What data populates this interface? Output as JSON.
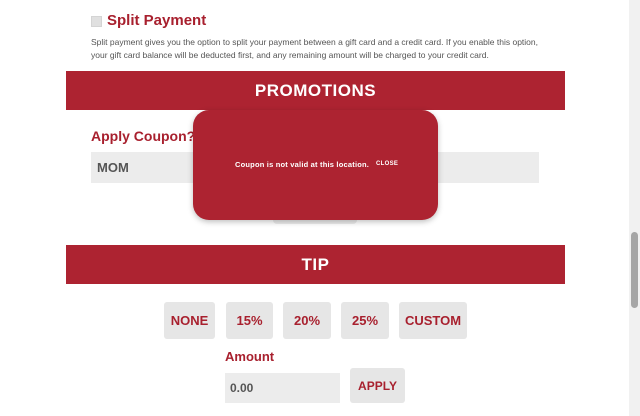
{
  "split_payment": {
    "title": "Split Payment",
    "description": "Split payment gives you the option to split your payment between a gift card and a credit card. If you enable this option, your gift card balance will be deducted first, and any remaining amount will be charged to your credit card."
  },
  "promotions": {
    "banner": "PROMOTIONS",
    "coupon_label": "Apply Coupon?",
    "coupon_value": "MOM"
  },
  "modal": {
    "message": "Coupon is not valid at this location.",
    "close_label": "CLOSE"
  },
  "tip": {
    "banner": "TIP",
    "options": [
      "NONE",
      "15%",
      "20%",
      "25%",
      "CUSTOM"
    ],
    "amount_label": "Amount",
    "amount_value": "0.00",
    "apply_label": "APPLY"
  },
  "colors": {
    "brand_red": "#ad2331",
    "button_bg": "#e6e6e6",
    "input_bg": "#ececec"
  }
}
